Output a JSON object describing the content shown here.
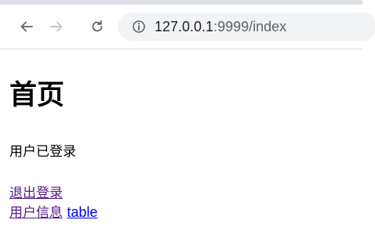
{
  "browser": {
    "url_host": "127.0.0.1",
    "url_rest": ":9999/index"
  },
  "page": {
    "title": "首页",
    "status": "用户已登录",
    "links": {
      "logout": "退出登录",
      "user_info": "用户信息",
      "table": "table"
    },
    "colors": {
      "visited_link": "#551a8b",
      "unvisited_link": "#0000ee"
    }
  }
}
